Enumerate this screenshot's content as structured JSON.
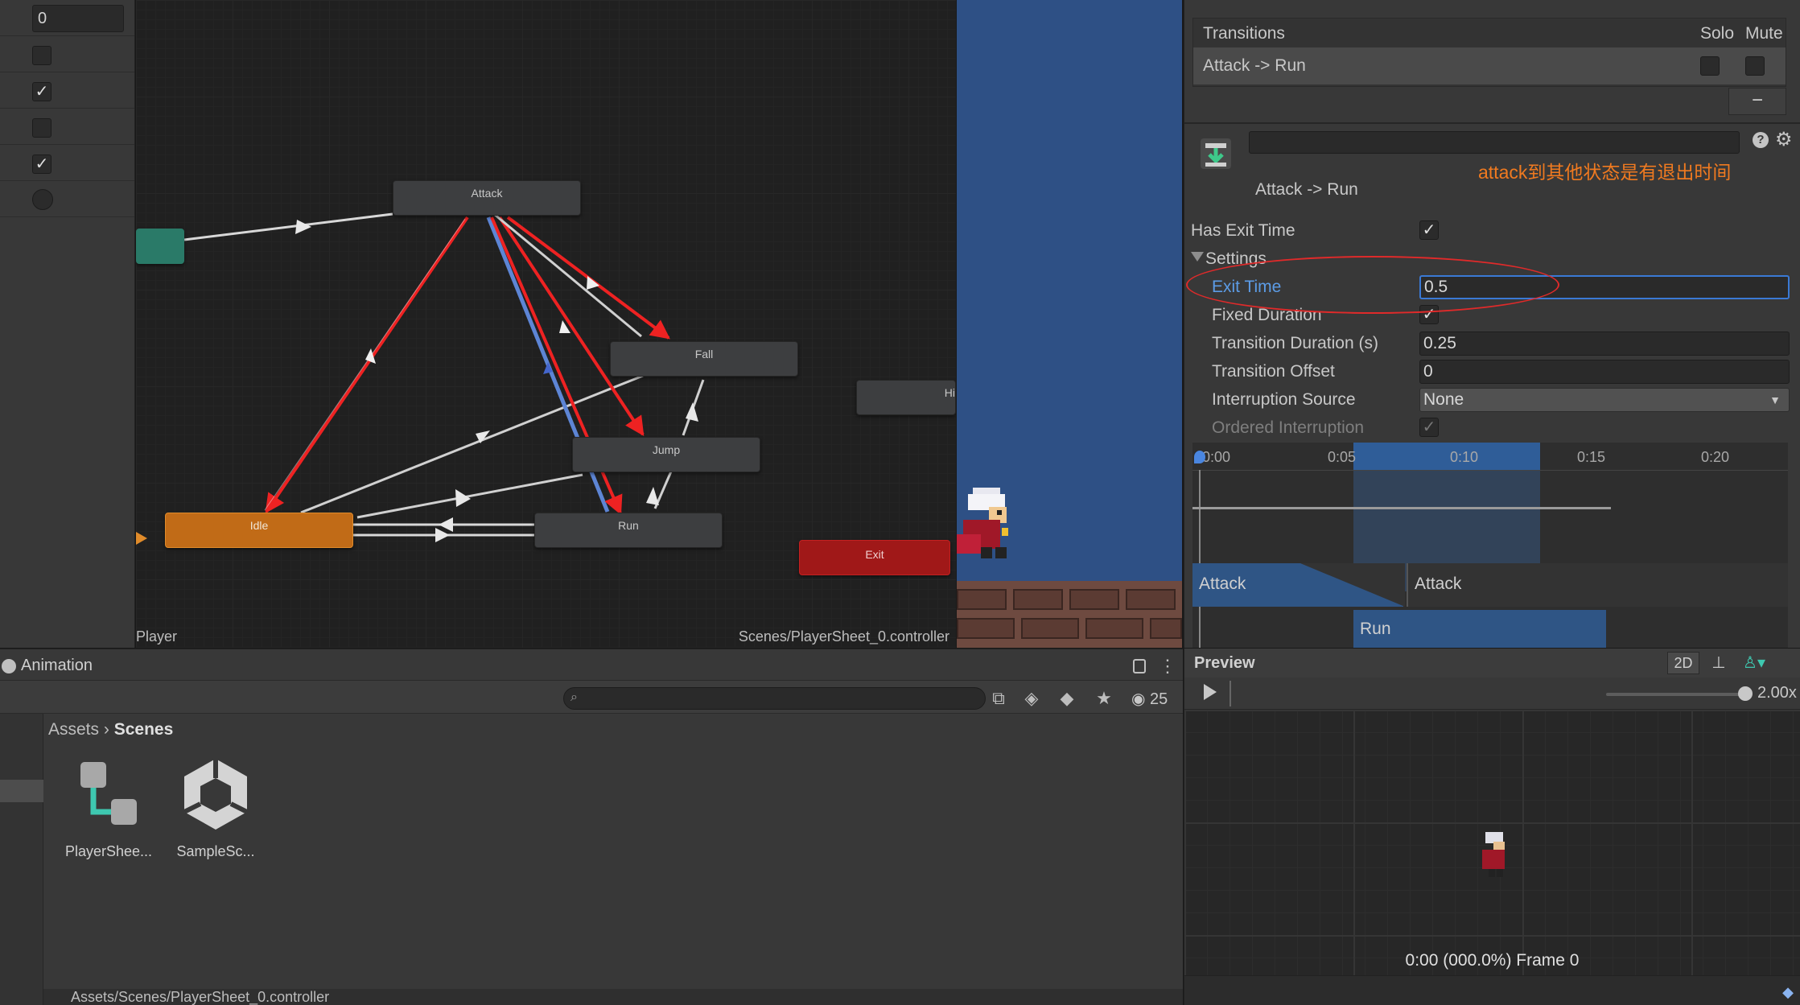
{
  "parameters": {
    "first_value": "0",
    "rows": [
      {
        "type": "bool",
        "checked": false
      },
      {
        "type": "bool",
        "checked": true
      },
      {
        "type": "bool",
        "checked": false
      },
      {
        "type": "bool",
        "checked": true
      },
      {
        "type": "trigger"
      }
    ]
  },
  "graph": {
    "states": {
      "attack": "Attack",
      "fall": "Fall",
      "jump": "Jump",
      "idle": "Idle",
      "run": "Run",
      "exit": "Exit",
      "hidden": "Hi"
    },
    "footer_left": "Player",
    "footer_right": "Scenes/PlayerSheet_0.controller"
  },
  "inspector": {
    "transitions_header": "Transitions",
    "solo_label": "Solo",
    "mute_label": "Mute",
    "transition_item": "Attack -> Run",
    "remove_label": "−",
    "subtitle": "Attack -> Run",
    "annotation": "attack到其他状态是有退出时间",
    "has_exit_time_label": "Has Exit Time",
    "settings_label": "Settings",
    "exit_time_label": "Exit Time",
    "exit_time_value": "0.5",
    "fixed_duration_label": "Fixed Duration",
    "transition_duration_label": "Transition Duration (s)",
    "transition_duration_value": "0.25",
    "transition_offset_label": "Transition Offset",
    "transition_offset_value": "0",
    "interruption_source_label": "Interruption Source",
    "interruption_source_value": "None",
    "ordered_interruption_label": "Ordered Interruption",
    "timeline": {
      "ticks": [
        "0:00",
        "0:05",
        "0:10",
        "0:15",
        "0:20"
      ],
      "bar_attack_1": "Attack",
      "bar_attack_2": "Attack",
      "bar_run": "Run"
    }
  },
  "project": {
    "tab": "Animation",
    "hidden_count": "25",
    "breadcrumb_root": "Assets",
    "breadcrumb_current": "Scenes",
    "assets": [
      {
        "name": "PlayerShee..."
      },
      {
        "name": "SampleSc..."
      }
    ],
    "status_path": "Assets/Scenes/PlayerSheet_0.controller"
  },
  "preview": {
    "title": "Preview",
    "mode_2d": "2D",
    "speed": "2.00x",
    "frame_label": "0:00 (000.0%) Frame 0"
  },
  "colors": {
    "idle_state": "#c16b17",
    "exit_state": "#a01818",
    "entry_state": "#2a7a68",
    "annotation": "#f07a20",
    "highlight_arrow": "#ee2222",
    "selection_blue": "#3a79d4"
  }
}
